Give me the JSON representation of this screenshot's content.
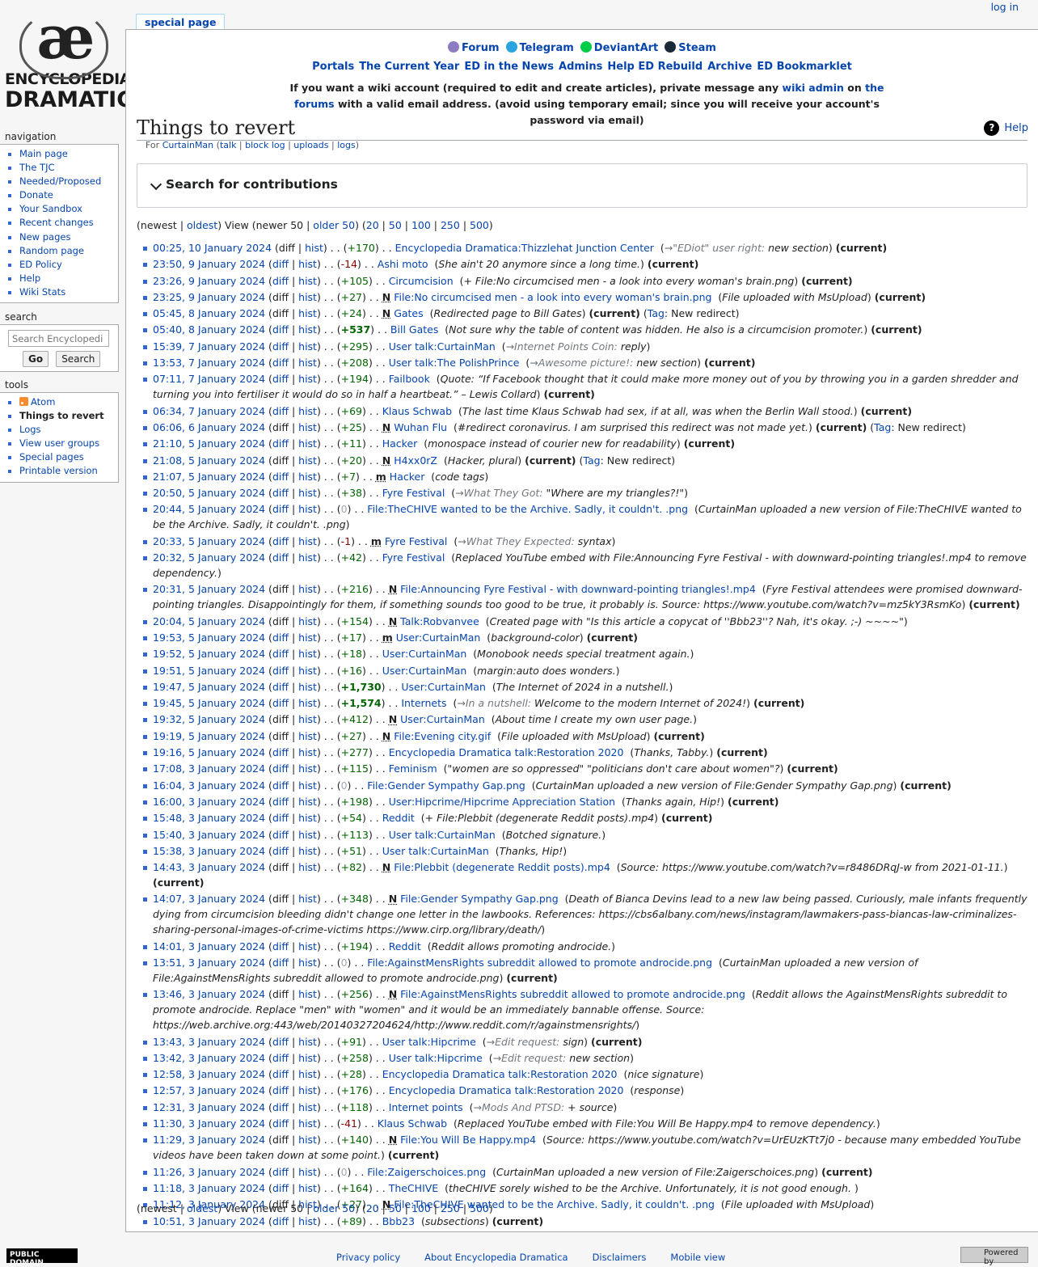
{
  "logo": {
    "symbol": "æ",
    "line1": "ENCYCLOPEDIA",
    "line2": "DRAMATICA"
  },
  "personal": {
    "login": "log in"
  },
  "tab": {
    "label": "special page"
  },
  "social": [
    {
      "label": "Forum",
      "icon": "forum-icon",
      "color": "#8e7cc3"
    },
    {
      "label": "Telegram",
      "icon": "telegram-icon",
      "color": "#2aa3df"
    },
    {
      "label": "DeviantArt",
      "icon": "deviantart-icon",
      "color": "#05cc47"
    },
    {
      "label": "Steam",
      "icon": "steam-icon",
      "color": "#1b2838"
    }
  ],
  "navlinks": [
    "Portals",
    "The Current Year",
    "ED in the News",
    "Admins",
    "Help ED Rebuild",
    "Archive",
    "ED Bookmarklet"
  ],
  "notice": {
    "pre": "If you want a wiki account (required to edit and create articles), private message any ",
    "link1": "wiki admin",
    "mid": " on ",
    "link2": "the forums",
    "post": " with a valid email address. (avoid using temporary email; since you will receive your account's password via email)"
  },
  "sidebar": {
    "navigation": {
      "heading": "navigation",
      "items": [
        "Main page",
        "The TJC",
        "Needed/Proposed",
        "Donate",
        "Your Sandbox",
        "Recent changes",
        "New pages",
        "Random page",
        "ED Policy",
        "Help",
        "Wiki Stats"
      ]
    },
    "search": {
      "heading": "search",
      "placeholder": "Search Encyclopedi",
      "go": "Go",
      "search": "Search"
    },
    "tools": {
      "heading": "tools",
      "items": [
        "Atom",
        "Things to revert",
        "Logs",
        "View user groups",
        "Special pages",
        "Printable version"
      ]
    }
  },
  "page": {
    "title": "Things to revert",
    "help": "Help",
    "sub": {
      "for": "For ",
      "user": "CurtainMan",
      "talk": "talk",
      "blocklog": "block log",
      "uploads": "uploads",
      "logs": "logs"
    },
    "search_contrib": "Search for contributions"
  },
  "pager": {
    "newest": "newest",
    "oldest": "oldest",
    "view": "View",
    "newer": "newer 50",
    "older": "older 50",
    "counts": [
      "20",
      "50",
      "100",
      "250",
      "500"
    ]
  },
  "labels": {
    "diff": "diff",
    "hist": "hist",
    "current": "(current)",
    "tag": "Tag",
    "new_redirect": "New redirect",
    "new": "N",
    "minor": "m"
  },
  "contribs": [
    {
      "date": "00:25, 10 January 2024",
      "diff": "",
      "size": "+170",
      "flag": "",
      "page": "Encyclopedia Dramatica:Thizzlehat Junction Center",
      "sec": "→\"EDiot\" user right:",
      "comment": "new section",
      "current": true,
      "tag": ""
    },
    {
      "date": "23:50, 9 January 2024",
      "diff": "y",
      "size": "-14",
      "flag": "",
      "page": "Ashi moto",
      "sec": "",
      "comment": "She ain't 20 anymore since a long time.",
      "current": true,
      "tag": ""
    },
    {
      "date": "23:26, 9 January 2024",
      "diff": "y",
      "size": "+105",
      "flag": "",
      "page": "Circumcision",
      "sec": "",
      "comment": "+ File:No circumcised men - a look into every woman's brain.png",
      "current": true,
      "tag": ""
    },
    {
      "date": "23:25, 9 January 2024",
      "diff": "",
      "size": "+27",
      "flag": "N",
      "page": "File:No circumcised men - a look into every woman's brain.png",
      "sec": "",
      "comment": "File uploaded with MsUpload",
      "current": true,
      "tag": ""
    },
    {
      "date": "05:45, 8 January 2024",
      "diff": "",
      "size": "+24",
      "flag": "N",
      "page": "Gates",
      "sec": "",
      "comment": "Redirected page to Bill Gates",
      "current": true,
      "tag": "y"
    },
    {
      "date": "05:40, 8 January 2024",
      "diff": "y",
      "size": "+537",
      "flag": "",
      "page": "Bill Gates",
      "sec": "",
      "comment": "Not sure why the table of content was hidden. He also is a circumcision promoter.",
      "current": true,
      "tag": ""
    },
    {
      "date": "15:39, 7 January 2024",
      "diff": "y",
      "size": "+295",
      "flag": "",
      "page": "User talk:CurtainMan",
      "sec": "→Internet Points Coin:",
      "comment": "reply",
      "current": false,
      "tag": ""
    },
    {
      "date": "13:53, 7 January 2024",
      "diff": "y",
      "size": "+208",
      "flag": "",
      "page": "User talk:The PolishPrince",
      "sec": "→Awesome picture!:",
      "comment": "new section",
      "current": true,
      "tag": ""
    },
    {
      "date": "07:11, 7 January 2024",
      "diff": "y",
      "size": "+194",
      "flag": "",
      "page": "Failbook",
      "sec": "",
      "comment": "Quote: “If Facebook thought that it could make more money out of you by throwing you in a garden shredder and turning you into fertiliser it would do so in half a heartbeat.” – Lewis Collard",
      "current": true,
      "tag": ""
    },
    {
      "date": "06:34, 7 January 2024",
      "diff": "y",
      "size": "+69",
      "flag": "",
      "page": "Klaus Schwab",
      "sec": "",
      "comment": "The last time Klaus Schwab had sex, if at all, was when the Berlin Wall stood.",
      "current": true,
      "tag": ""
    },
    {
      "date": "06:06, 6 January 2024",
      "diff": "",
      "size": "+25",
      "flag": "N",
      "page": "Wuhan Flu",
      "sec": "",
      "comment": "#redirect coronavirus. I am surprised this redirect was not made yet.",
      "current": true,
      "tag": "y"
    },
    {
      "date": "21:10, 5 January 2024",
      "diff": "y",
      "size": "+11",
      "flag": "",
      "page": "Hacker",
      "sec": "",
      "comment": "monospace instead of courier new for readability",
      "current": true,
      "tag": ""
    },
    {
      "date": "21:08, 5 January 2024",
      "diff": "",
      "size": "+20",
      "flag": "N",
      "page": "H4xx0rZ",
      "sec": "",
      "comment": "Hacker, plural",
      "current": true,
      "tag": "y"
    },
    {
      "date": "21:07, 5 January 2024",
      "diff": "y",
      "size": "+7",
      "flag": "m",
      "page": "Hacker",
      "sec": "",
      "comment": "code tags",
      "current": false,
      "tag": ""
    },
    {
      "date": "20:50, 5 January 2024",
      "diff": "y",
      "size": "+38",
      "flag": "",
      "page": "Fyre Festival",
      "sec": "→What They Got:",
      "comment": "\"Where are my triangles?!\"",
      "current": false,
      "tag": ""
    },
    {
      "date": "20:44, 5 January 2024",
      "diff": "y",
      "size": "0",
      "flag": "",
      "page": "File:TheCHIVE wanted to be the Archive. Sadly, it couldn't. .png",
      "sec": "",
      "comment": "CurtainMan uploaded a new version of File:TheCHIVE wanted to be the Archive. Sadly, it couldn't. .png",
      "current": false,
      "tag": ""
    },
    {
      "date": "20:33, 5 January 2024",
      "diff": "y",
      "size": "-1",
      "flag": "m",
      "page": "Fyre Festival",
      "sec": "→What They Expected:",
      "comment": "syntax",
      "current": false,
      "tag": ""
    },
    {
      "date": "20:32, 5 January 2024",
      "diff": "y",
      "size": "+42",
      "flag": "",
      "page": "Fyre Festival",
      "sec": "",
      "comment": "Replaced YouTube embed with File:Announcing Fyre Festival - with downward-pointing triangles!.mp4 to remove dependency.",
      "current": false,
      "tag": ""
    },
    {
      "date": "20:31, 5 January 2024",
      "diff": "",
      "size": "+216",
      "flag": "N",
      "page": "File:Announcing Fyre Festival - with downward-pointing triangles!.mp4",
      "sec": "",
      "comment": "Fyre Festival attendees were promised downward-pointing triangles. Disappointingly for them, if something sounds too good to be true, it probably is. Source: https://www.youtube.com/watch?v=mz5kY3RsmKo",
      "current": true,
      "tag": ""
    },
    {
      "date": "20:04, 5 January 2024",
      "diff": "",
      "size": "+154",
      "flag": "N",
      "page": "Talk:Robvanvee",
      "sec": "",
      "comment": "Created page with \"Is this article a copycat of ''Bbb23''? Nah, it's okay. ;-) ~~~~\"",
      "current": false,
      "tag": ""
    },
    {
      "date": "19:53, 5 January 2024",
      "diff": "y",
      "size": "+17",
      "flag": "m",
      "page": "User:CurtainMan",
      "sec": "",
      "comment": "background-color",
      "current": true,
      "tag": ""
    },
    {
      "date": "19:52, 5 January 2024",
      "diff": "y",
      "size": "+18",
      "flag": "",
      "page": "User:CurtainMan",
      "sec": "",
      "comment": "Monobook needs special treatment again.",
      "current": false,
      "tag": ""
    },
    {
      "date": "19:51, 5 January 2024",
      "diff": "y",
      "size": "+16",
      "flag": "",
      "page": "User:CurtainMan",
      "sec": "",
      "comment": "margin:auto does wonders.",
      "current": false,
      "tag": ""
    },
    {
      "date": "19:47, 5 January 2024",
      "diff": "y",
      "size": "+1,730",
      "flag": "",
      "page": "User:CurtainMan",
      "sec": "",
      "comment": "The Internet of 2024 in a nutshell.",
      "current": false,
      "tag": ""
    },
    {
      "date": "19:45, 5 January 2024",
      "diff": "y",
      "size": "+1,574",
      "flag": "",
      "page": "Internets",
      "sec": "→In a nutshell:",
      "comment": "Welcome to the modern Internet of 2024!",
      "current": true,
      "tag": ""
    },
    {
      "date": "19:32, 5 January 2024",
      "diff": "",
      "size": "+412",
      "flag": "N",
      "page": "User:CurtainMan",
      "sec": "",
      "comment": "About time I create my own user page.",
      "current": false,
      "tag": ""
    },
    {
      "date": "19:19, 5 January 2024",
      "diff": "",
      "size": "+27",
      "flag": "N",
      "page": "File:Evening city.gif",
      "sec": "",
      "comment": "File uploaded with MsUpload",
      "current": true,
      "tag": ""
    },
    {
      "date": "19:16, 5 January 2024",
      "diff": "y",
      "size": "+277",
      "flag": "",
      "page": "Encyclopedia Dramatica talk:Restoration 2020",
      "sec": "",
      "comment": "Thanks, Tabby.",
      "current": true,
      "tag": ""
    },
    {
      "date": "17:08, 3 January 2024",
      "diff": "y",
      "size": "+115",
      "flag": "",
      "page": "Feminism",
      "sec": "",
      "comment": "\"women are so oppressed\" \"politicians don't care about women\"?",
      "current": true,
      "tag": ""
    },
    {
      "date": "16:04, 3 January 2024",
      "diff": "y",
      "size": "0",
      "flag": "",
      "page": "File:Gender Sympathy Gap.png",
      "sec": "",
      "comment": "CurtainMan uploaded a new version of File:Gender Sympathy Gap.png",
      "current": true,
      "tag": ""
    },
    {
      "date": "16:00, 3 January 2024",
      "diff": "y",
      "size": "+198",
      "flag": "",
      "page": "User:Hipcrime/Hipcrime Appreciation Station",
      "sec": "",
      "comment": "Thanks again, Hip!",
      "current": true,
      "tag": ""
    },
    {
      "date": "15:48, 3 January 2024",
      "diff": "y",
      "size": "+54",
      "flag": "",
      "page": "Reddit",
      "sec": "",
      "comment": "+ File:Plebbit (degenerate Reddit posts).mp4",
      "current": true,
      "tag": ""
    },
    {
      "date": "15:40, 3 January 2024",
      "diff": "y",
      "size": "+113",
      "flag": "",
      "page": "User talk:CurtainMan",
      "sec": "",
      "comment": "Botched signature.",
      "current": false,
      "tag": ""
    },
    {
      "date": "15:38, 3 January 2024",
      "diff": "y",
      "size": "+51",
      "flag": "",
      "page": "User talk:CurtainMan",
      "sec": "",
      "comment": "Thanks, Hip!",
      "current": false,
      "tag": ""
    },
    {
      "date": "14:43, 3 January 2024",
      "diff": "",
      "size": "+82",
      "flag": "N",
      "page": "File:Plebbit (degenerate Reddit posts).mp4",
      "sec": "",
      "comment": "Source: https://www.youtube.com/watch?v=r8486DRqJ-w from 2021-01-11.",
      "current": true,
      "tag": ""
    },
    {
      "date": "14:07, 3 January 2024",
      "diff": "",
      "size": "+348",
      "flag": "N",
      "page": "File:Gender Sympathy Gap.png",
      "sec": "",
      "comment": "Death of Bianca Devins lead to a new law being passed. Curiously, male infants frequently dying from circumcision bleeding didn't change one letter in the lawbooks. References: https://cbs6albany.com/news/instagram/lawmakers-pass-biancas-law-criminalizes-sharing-personal-images-of-crime-victims https://www.cirp.org/library/death/",
      "current": false,
      "tag": ""
    },
    {
      "date": "14:01, 3 January 2024",
      "diff": "y",
      "size": "+194",
      "flag": "",
      "page": "Reddit",
      "sec": "",
      "comment": "Reddit allows promoting androcide.",
      "current": false,
      "tag": ""
    },
    {
      "date": "13:51, 3 January 2024",
      "diff": "y",
      "size": "0",
      "flag": "",
      "page": "File:AgainstMensRights subreddit allowed to promote androcide.png",
      "sec": "",
      "comment": "CurtainMan uploaded a new version of File:AgainstMensRights subreddit allowed to promote androcide.png",
      "current": true,
      "tag": ""
    },
    {
      "date": "13:46, 3 January 2024",
      "diff": "",
      "size": "+256",
      "flag": "N",
      "page": "File:AgainstMensRights subreddit allowed to promote androcide.png",
      "sec": "",
      "comment": "Reddit allows the AgainstMensRights subreddit to promote androcide. Replace \"men\" with \"women\" and it would be an immediately bannable offense. Source: https://web.archive.org:443/web/20140327204624/http://www.reddit.com/r/againstmensrights/",
      "current": false,
      "tag": ""
    },
    {
      "date": "13:43, 3 January 2024",
      "diff": "y",
      "size": "+91",
      "flag": "",
      "page": "User talk:Hipcrime",
      "sec": "→Edit request:",
      "comment": "sign",
      "current": true,
      "tag": ""
    },
    {
      "date": "13:42, 3 January 2024",
      "diff": "y",
      "size": "+258",
      "flag": "",
      "page": "User talk:Hipcrime",
      "sec": "→Edit request:",
      "comment": "new section",
      "current": false,
      "tag": ""
    },
    {
      "date": "12:58, 3 January 2024",
      "diff": "y",
      "size": "+28",
      "flag": "",
      "page": "Encyclopedia Dramatica talk:Restoration 2020",
      "sec": "",
      "comment": "nice signature",
      "current": false,
      "tag": ""
    },
    {
      "date": "12:57, 3 January 2024",
      "diff": "y",
      "size": "+176",
      "flag": "",
      "page": "Encyclopedia Dramatica talk:Restoration 2020",
      "sec": "",
      "comment": "response",
      "current": false,
      "tag": ""
    },
    {
      "date": "12:31, 3 January 2024",
      "diff": "y",
      "size": "+118",
      "flag": "",
      "page": "Internet points",
      "sec": "→Mods And PTSD:",
      "comment": "+ source",
      "current": false,
      "tag": ""
    },
    {
      "date": "11:30, 3 January 2024",
      "diff": "y",
      "size": "-41",
      "flag": "",
      "page": "Klaus Schwab",
      "sec": "",
      "comment": "Replaced YouTube embed with File:You Will Be Happy.mp4 to remove dependency.",
      "current": false,
      "tag": ""
    },
    {
      "date": "11:29, 3 January 2024",
      "diff": "",
      "size": "+140",
      "flag": "N",
      "page": "File:You Will Be Happy.mp4",
      "sec": "",
      "comment": "Source: https://www.youtube.com/watch?v=UrEUzKTt7j0 - because many embedded YouTube videos have been taken down at some point.",
      "current": true,
      "tag": ""
    },
    {
      "date": "11:26, 3 January 2024",
      "diff": "y",
      "size": "0",
      "flag": "",
      "page": "File:Zaigerschoices.png",
      "sec": "",
      "comment": "CurtainMan uploaded a new version of File:Zaigerschoices.png",
      "current": true,
      "tag": ""
    },
    {
      "date": "11:18, 3 January 2024",
      "diff": "y",
      "size": "+164",
      "flag": "",
      "page": "TheCHIVE",
      "sec": "",
      "comment": "theCHIVE sorely wished to be the Archive. Unfortunately, it is not good enough. ",
      "current": false,
      "tag": ""
    },
    {
      "date": "11:12, 3 January 2024",
      "diff": "",
      "size": "+27",
      "flag": "N",
      "page": "File:TheCHIVE wanted to be the Archive. Sadly, it couldn't. .png",
      "sec": "",
      "comment": "File uploaded with MsUpload",
      "current": false,
      "tag": ""
    },
    {
      "date": "10:51, 3 January 2024",
      "diff": "y",
      "size": "+89",
      "flag": "",
      "page": "Bbb23",
      "sec": "",
      "comment": "subsections",
      "current": true,
      "tag": ""
    }
  ],
  "footer": {
    "license": "PUBLIC DOMAIN",
    "links": [
      "Privacy policy",
      "About Encyclopedia Dramatica",
      "Disclaimers",
      "Mobile view"
    ],
    "powered": "Powered by"
  }
}
